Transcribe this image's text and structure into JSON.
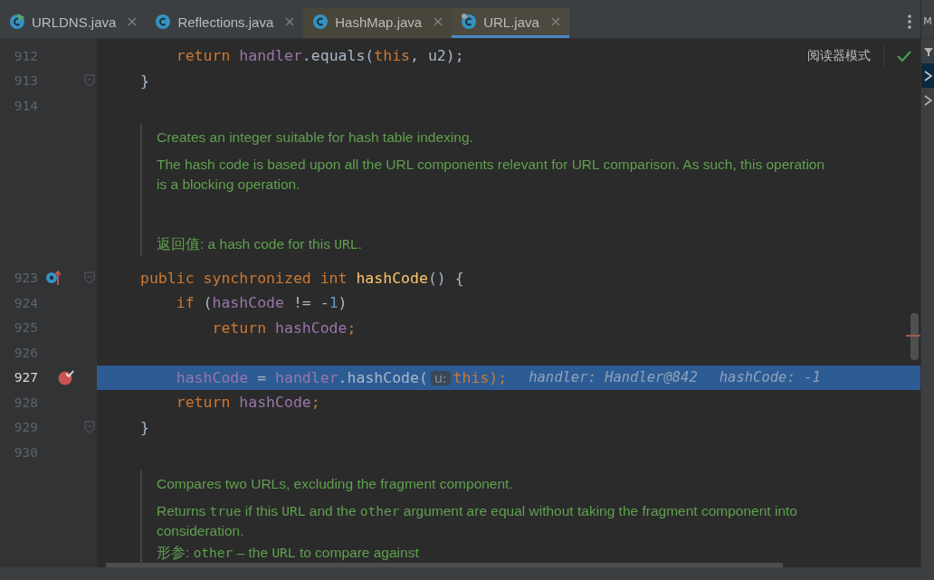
{
  "tabs": [
    {
      "label": "URLDNS.java",
      "kind": "run",
      "tinted": false,
      "selected": false
    },
    {
      "label": "Reflections.java",
      "kind": "plain",
      "tinted": false,
      "selected": false
    },
    {
      "label": "HashMap.java",
      "kind": "plain",
      "tinted": true,
      "selected": false
    },
    {
      "label": "URL.java",
      "kind": "locked",
      "tinted": true,
      "selected": true
    }
  ],
  "right_panel": {
    "title": "M"
  },
  "reader_mode": {
    "label": "阅读器模式"
  },
  "editor": {
    "lines": [
      {
        "kind": "code",
        "number": "912",
        "current": false,
        "tokens": [
          {
            "t": "    return ",
            "kind": "keyword"
          },
          {
            "t": "handler",
            "kind": "field"
          },
          {
            "t": ".equals(",
            "kind": "plain"
          },
          {
            "t": "this",
            "kind": "keyword"
          },
          {
            "t": ", u2);",
            "kind": "plain"
          }
        ]
      },
      {
        "kind": "code",
        "number": "913",
        "current": false,
        "gutter_icons": [
          {
            "kind": "fold"
          }
        ],
        "tokens": [
          {
            "t": "}",
            "kind": "plain"
          }
        ]
      },
      {
        "kind": "code",
        "number": "914",
        "current": false
      },
      {
        "kind": "doc",
        "paragraphs": [
          {
            "kind": "text",
            "segments": [
              {
                "t": "Creates an integer suitable for hash table indexing.",
                "kind": "text"
              }
            ]
          },
          {
            "kind": "text",
            "segments": [
              {
                "t": "The hash code is based upon all the URL components relevant for URL comparison. As such, this operation is a blocking operation.",
                "kind": "text"
              }
            ]
          },
          {
            "kind": "tag",
            "segments": [
              {
                "t": "返回值: a hash code for this ",
                "kind": "text"
              },
              {
                "t": "URL",
                "kind": "code"
              },
              {
                "t": ".",
                "kind": "text"
              }
            ]
          }
        ]
      },
      {
        "kind": "code",
        "number": "923",
        "current": false,
        "gutter_icons": [
          {
            "kind": "override"
          },
          {
            "kind": "fold"
          }
        ],
        "tokens": [
          {
            "t": "public synchronized int ",
            "kind": "keyword"
          },
          {
            "t": "hashCode",
            "kind": "method"
          },
          {
            "t": "() {",
            "kind": "plain"
          }
        ]
      },
      {
        "kind": "code",
        "number": "924",
        "current": false,
        "tokens": [
          {
            "t": "    if ",
            "kind": "keyword"
          },
          {
            "t": "(",
            "kind": "plain"
          },
          {
            "t": "hashCode",
            "kind": "field"
          },
          {
            "t": " != -",
            "kind": "plain"
          },
          {
            "t": "1",
            "kind": "number"
          },
          {
            "t": ")",
            "kind": "plain"
          }
        ]
      },
      {
        "kind": "code",
        "number": "925",
        "current": false,
        "tokens": [
          {
            "t": "        return ",
            "kind": "keyword"
          },
          {
            "t": "hashCode",
            "kind": "field"
          },
          {
            "t": ";",
            "kind": "keyword"
          }
        ]
      },
      {
        "kind": "code",
        "number": "926",
        "current": false
      },
      {
        "kind": "code",
        "number": "927",
        "current": true,
        "gutter_icons": [
          {
            "kind": "breakpoint"
          }
        ],
        "tokens": [
          {
            "t": "    hashCode",
            "kind": "field"
          },
          {
            "t": " = ",
            "kind": "plain"
          },
          {
            "t": "handler",
            "kind": "field"
          },
          {
            "t": ".hashCode(",
            "kind": "plain"
          },
          {
            "t": "u:",
            "kind": "hint"
          },
          {
            "t": "this",
            "kind": "keyword"
          },
          {
            "t": ");",
            "kind": "keyword"
          }
        ],
        "inline_values": [
          "handler: Handler@842",
          "hashCode: -1"
        ]
      },
      {
        "kind": "code",
        "number": "928",
        "current": false,
        "tokens": [
          {
            "t": "    return ",
            "kind": "keyword"
          },
          {
            "t": "hashCode",
            "kind": "field"
          },
          {
            "t": ";",
            "kind": "keyword"
          }
        ]
      },
      {
        "kind": "code",
        "number": "929",
        "current": false,
        "gutter_icons": [
          {
            "kind": "fold"
          }
        ],
        "tokens": [
          {
            "t": "}",
            "kind": "plain"
          }
        ]
      },
      {
        "kind": "code",
        "number": "930",
        "current": false
      },
      {
        "kind": "doc",
        "paragraphs": [
          {
            "kind": "text",
            "segments": [
              {
                "t": "Compares two URLs, excluding the fragment component.",
                "kind": "text"
              }
            ]
          },
          {
            "kind": "text",
            "segments": [
              {
                "t": "Returns ",
                "kind": "text"
              },
              {
                "t": "true",
                "kind": "code"
              },
              {
                "t": " if this ",
                "kind": "text"
              },
              {
                "t": "URL",
                "kind": "code"
              },
              {
                "t": " and the ",
                "kind": "text"
              },
              {
                "t": "other",
                "kind": "code"
              },
              {
                "t": " argument are equal without taking the fragment component into consideration.",
                "kind": "text"
              }
            ]
          },
          {
            "kind": "text",
            "segments": [
              {
                "t": "形参:  ",
                "kind": "text"
              },
              {
                "t": "other",
                "kind": "code"
              },
              {
                "t": " – the ",
                "kind": "text"
              },
              {
                "t": "URL",
                "kind": "code"
              },
              {
                "t": " to compare against",
                "kind": "text"
              }
            ]
          }
        ]
      }
    ]
  }
}
